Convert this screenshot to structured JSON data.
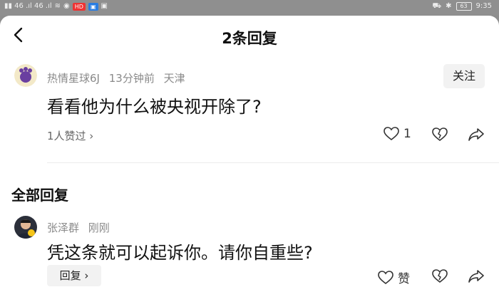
{
  "status_bar": {
    "left_text": "▮▮ 46 .ıl 46 .ıl",
    "badge_red": "HD",
    "badge_blue": "▣",
    "battery": "63",
    "time": "9:35"
  },
  "header": {
    "title": "2条回复"
  },
  "main_comment": {
    "author": "热情星球6J",
    "time": "13分钟前",
    "location": "天津",
    "text": "看看他为什么被央视开除了?",
    "likes_text": "1人赞过 ›",
    "follow_label": "关注",
    "like_count": "1"
  },
  "section": {
    "title": "全部回复"
  },
  "reply": {
    "author": "张泽群",
    "time": "刚刚",
    "text": "凭这条就可以起诉你。请你自重些?",
    "reply_label": "回复 ›",
    "like_label": "赞"
  }
}
